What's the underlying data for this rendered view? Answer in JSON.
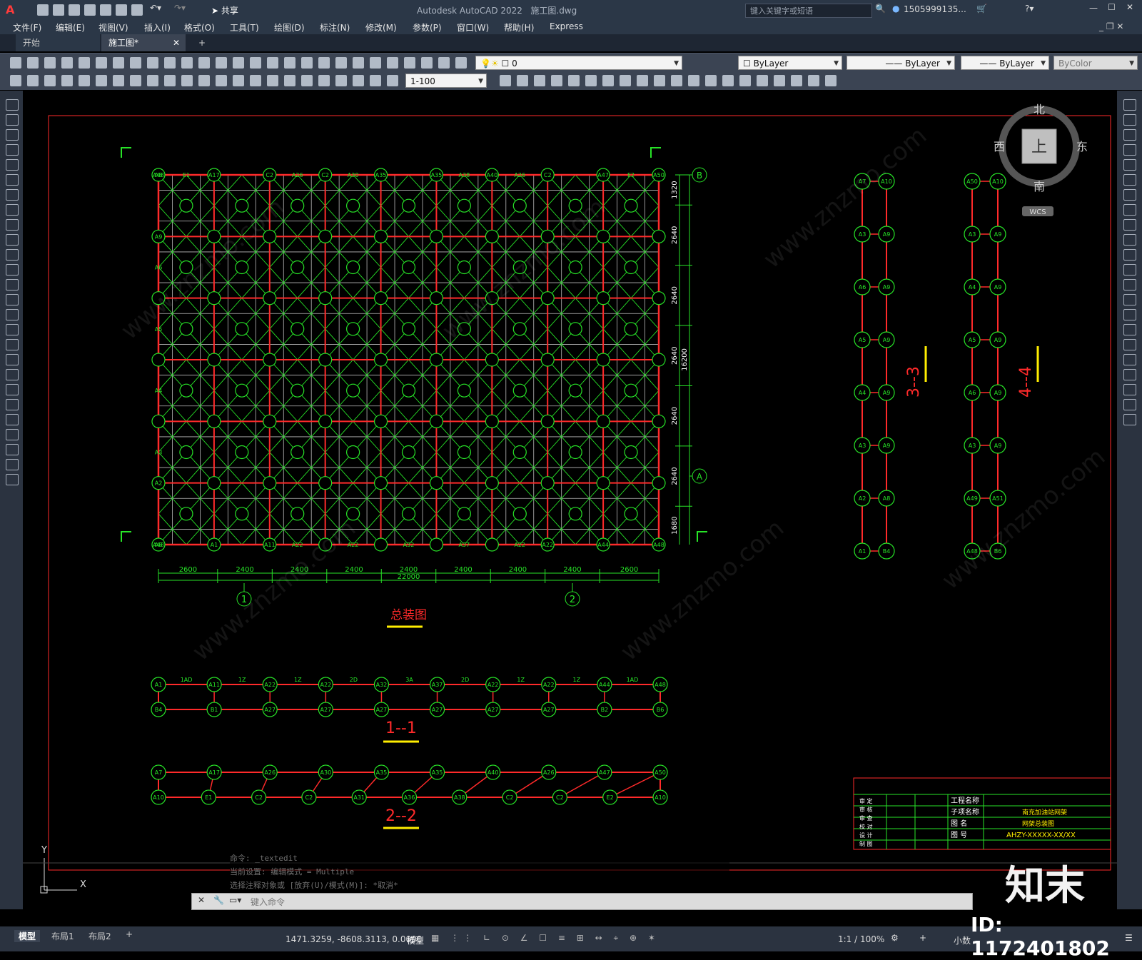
{
  "window": {
    "title": "Autodesk AutoCAD 2022",
    "file": "施工图.dwg",
    "share_label": "共享",
    "search_placeholder": "键入关键字或短语",
    "user": "1505999135...",
    "logo": "A"
  },
  "menu": [
    "文件(F)",
    "编辑(E)",
    "视图(V)",
    "插入(I)",
    "格式(O)",
    "工具(T)",
    "绘图(D)",
    "标注(N)",
    "修改(M)",
    "参数(P)",
    "窗口(W)",
    "帮助(H)",
    "Express"
  ],
  "tabs": {
    "start": "开始",
    "drawing": "施工图*",
    "add": "+"
  },
  "toolbar": {
    "layer": "0",
    "color": "ByLayer",
    "linetype": "ByLayer",
    "lineweight": "ByLayer",
    "plotstyle": "ByColor",
    "scale": "1-100"
  },
  "viewcube": {
    "north": "北",
    "south": "南",
    "west": "西",
    "east": "东",
    "top": "上",
    "wcs": "WCS"
  },
  "drawing": {
    "main_title": "总装图",
    "section_1": "1--1",
    "section_2": "2--2",
    "section_3": "3--3",
    "section_4": "4--4",
    "dims_bottom": [
      "2600",
      "2400",
      "2400",
      "2400",
      "2400",
      "2400",
      "2400",
      "2400",
      "2600"
    ],
    "dim_total_bottom": "22000",
    "dims_right": [
      "1320",
      "2640",
      "2640",
      "2640",
      "2640",
      "2640",
      "1680"
    ],
    "dim_total_right": "16200",
    "axis_1": "1",
    "axis_2": "2",
    "axis_a": "A",
    "axis_b": "B",
    "row1_top": [
      "A1",
      "A11",
      "A22",
      "A22",
      "A32",
      "A37",
      "A22",
      "A22",
      "A44",
      "A48"
    ],
    "row1_bot": [
      "B4",
      "B1",
      "A27",
      "A27",
      "A27",
      "A27",
      "A27",
      "A27",
      "B2",
      "B6"
    ],
    "row1_labels": [
      "1AD",
      "1Z",
      "1Z",
      "2D",
      "3A",
      "2D",
      "1Z",
      "1Z",
      "1AD"
    ],
    "row2_top": [
      "A7",
      "A17",
      "A26",
      "A30",
      "A35",
      "A35",
      "A40",
      "A26",
      "A47",
      "A50"
    ],
    "row2_bot": [
      "A10",
      "E1",
      "C2",
      "C2",
      "A31",
      "A36",
      "A38",
      "C2",
      "C2",
      "E2",
      "A10"
    ],
    "sec3_left": [
      "A7",
      "A3",
      "A6",
      "A5",
      "A4",
      "A3",
      "A2",
      "A1"
    ],
    "sec3_right": [
      "A10",
      "A9",
      "A9",
      "A9",
      "A9",
      "A9",
      "A8",
      "B4"
    ],
    "sec4_left": [
      "A50",
      "A3",
      "A4",
      "A5",
      "A6",
      "A3",
      "A49",
      "A48"
    ],
    "sec4_right": [
      "A10",
      "A9",
      "A9",
      "A9",
      "A9",
      "A9",
      "A51",
      "B6"
    ],
    "grid_top_row": [
      "A48",
      "E1",
      "A17",
      "C2",
      "A26",
      "C2",
      "A30",
      "A35",
      "A35",
      "A38",
      "A40",
      "A26",
      "C2",
      "A47",
      "E2",
      "A50"
    ],
    "grid_col_left": [
      "A8",
      "A9",
      "A6",
      "A5",
      "A4",
      "A3",
      "A2",
      "A48"
    ],
    "grid_bottom_row": [
      "A8",
      "A1",
      "A11",
      "A22",
      "A22",
      "A32",
      "A37",
      "A22",
      "A22",
      "A44",
      "A48"
    ]
  },
  "title_block": {
    "project_label": "工程名称",
    "sub_label": "子项名称",
    "sub_value": "南充加油站网架",
    "drawing_label": "图 名",
    "drawing_value": "网架总装图",
    "number_label": "图 号",
    "number_value": "AHZY-XXXXX-XX/XX",
    "rows": [
      "审 定",
      "审 核",
      "审 查",
      "校 对",
      "设 计",
      "制 图"
    ]
  },
  "command": {
    "history": [
      "命令: _textedit",
      "当前设置: 编辑模式 = Multiple",
      "选择注释对象或 [放弃(U)/模式(M)]: *取消*"
    ],
    "placeholder": "键入命令"
  },
  "layout_tabs": [
    "模型",
    "布局1",
    "布局2",
    "+"
  ],
  "status": {
    "coords": "1471.3259, -8608.3113, 0.0000",
    "space": "模型",
    "scale": "1:1 / 100%",
    "units": "小数"
  },
  "watermark": {
    "brand": "知末",
    "id": "ID: 1172401802",
    "site": "www.znzmo.com"
  },
  "colors": {
    "red": "#ff2a2a",
    "green": "#27e327",
    "yellow": "#ffee00",
    "bg": "#000000"
  }
}
